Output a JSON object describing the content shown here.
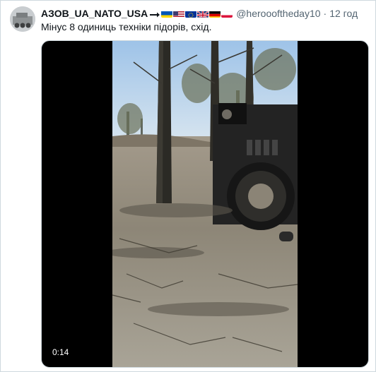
{
  "user": {
    "display_name": "АЗОВ_UA_NATO_USA",
    "handle": "@heroofthe day10",
    "handle_text": "@heroooftheday10",
    "time": "12 год",
    "separator": "·",
    "flag_icons": [
      "arrow-soon-icon",
      "ukraine-flag-icon",
      "usa-flag-icon",
      "eu-flag-icon",
      "uk-flag-icon",
      "germany-flag-icon",
      "poland-flag-icon"
    ]
  },
  "tweet": {
    "text": "Мінус 8 одиниць техніки підорів, схід."
  },
  "video": {
    "duration": "0:14"
  },
  "colors": {
    "border": "#cfd9de",
    "secondary_text": "#536471",
    "text": "#0f1419"
  }
}
